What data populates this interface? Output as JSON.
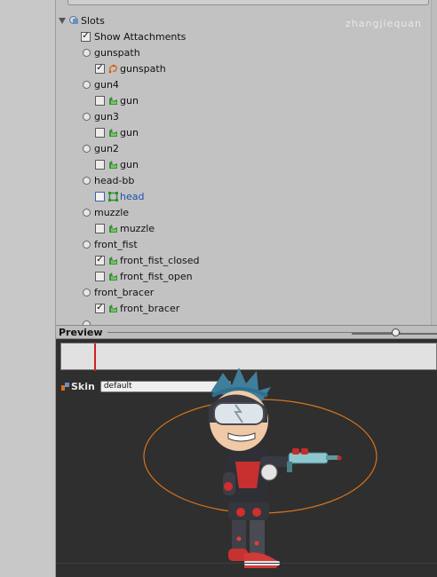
{
  "watermark": "zhangjiequan",
  "slots": {
    "header": "Slots",
    "show_attachments": {
      "label": "Show Attachments",
      "checked": true
    },
    "items": [
      {
        "slot": "gunspath",
        "attachments": [
          {
            "name": "gunspath",
            "checked": true,
            "icon": "path-icon"
          }
        ]
      },
      {
        "slot": "gun4",
        "attachments": [
          {
            "name": "gun",
            "checked": false,
            "icon": "region-icon"
          }
        ]
      },
      {
        "slot": "gun3",
        "attachments": [
          {
            "name": "gun",
            "checked": false,
            "icon": "region-icon"
          }
        ]
      },
      {
        "slot": "gun2",
        "attachments": [
          {
            "name": "gun",
            "checked": false,
            "icon": "region-icon"
          }
        ]
      },
      {
        "slot": "head-bb",
        "attachments": [
          {
            "name": "head",
            "checked": false,
            "icon": "boundingbox-icon"
          }
        ]
      },
      {
        "slot": "muzzle",
        "attachments": [
          {
            "name": "muzzle",
            "checked": false,
            "icon": "region-icon"
          }
        ]
      },
      {
        "slot": "front_fist",
        "attachments": [
          {
            "name": "front_fist_closed",
            "checked": true,
            "icon": "region-icon"
          },
          {
            "name": "front_fist_open",
            "checked": false,
            "icon": "region-icon"
          }
        ]
      },
      {
        "slot": "front_bracer",
        "attachments": [
          {
            "name": "front_bracer",
            "checked": true,
            "icon": "region-icon"
          }
        ]
      }
    ]
  },
  "preview": {
    "title": "Preview",
    "skin_label": "Skin",
    "skin_value": "default"
  },
  "colors": {
    "bounds_ellipse": "#d9731c",
    "playhead": "#cc2222",
    "region_icon": "#3f8f3a"
  }
}
